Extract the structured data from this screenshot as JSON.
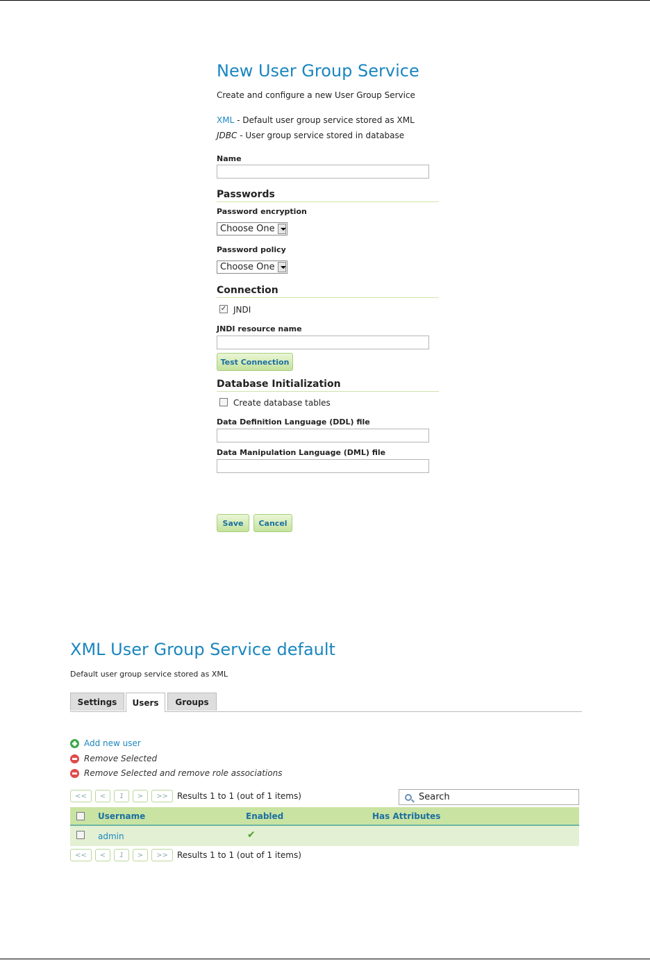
{
  "new_service": {
    "title": "New User Group Service",
    "description": "Create and configure a new User Group Service",
    "options": [
      {
        "name": "XML",
        "desc": " - Default user group service stored as XML"
      },
      {
        "name": "JDBC",
        "desc": " - User group service stored in database"
      }
    ],
    "name_label": "Name",
    "passwords_section": "Passwords",
    "password_encryption_label": "Password encryption",
    "password_encryption_value": "Choose One",
    "password_policy_label": "Password policy",
    "password_policy_value": "Choose One",
    "connection_section": "Connection",
    "jndi_label": "JNDI",
    "jndi_checked": true,
    "jndi_resource_label": "JNDI resource name",
    "test_connection_label": "Test Connection",
    "db_init_section": "Database Initialization",
    "create_tables_label": "Create database tables",
    "create_tables_checked": false,
    "ddl_label": "Data Definition Language (DDL) file",
    "dml_label": "Data Manipulation Language (DML) file",
    "save_label": "Save",
    "cancel_label": "Cancel"
  },
  "xml_service": {
    "title": "XML User Group Service default",
    "description": "Default user group service stored as XML",
    "tabs": [
      {
        "label": "Settings",
        "active": false
      },
      {
        "label": "Users",
        "active": true
      },
      {
        "label": "Groups",
        "active": false
      }
    ],
    "actions": {
      "add_user": "Add new user",
      "remove_selected": "Remove Selected",
      "remove_selected_roles": "Remove Selected and remove role associations"
    },
    "pager": {
      "first": "<<",
      "prev": "<",
      "page": "1",
      "next": ">",
      "last": ">>",
      "results": "Results 1 to 1 (out of 1 items)"
    },
    "search_placeholder": "Search",
    "table": {
      "columns": [
        "Username",
        "Enabled",
        "Has Attributes"
      ],
      "rows": [
        {
          "username": "admin",
          "enabled": true,
          "has_attributes": false
        }
      ]
    },
    "colors": {
      "link": "#1a86bf",
      "header_bg": "#c9e3a3",
      "row_bg": "#e3f0d3",
      "check": "#4aa02c",
      "add_icon": "#3ea84b",
      "remove_icon": "#e04b4b"
    }
  }
}
